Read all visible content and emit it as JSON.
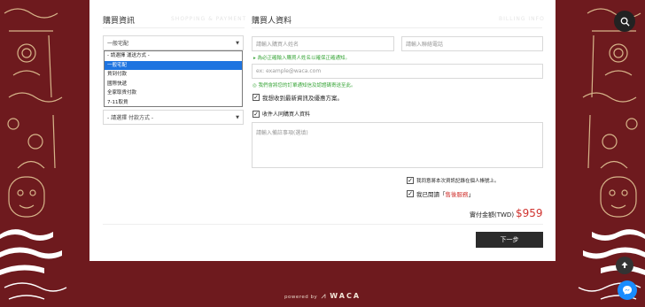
{
  "left_section": {
    "title": "購買資訊",
    "title_en": "SHOPPING & PAYMENT",
    "shipping_select_value": "一般宅配",
    "shipping_options": [
      "- 請選擇 運送方式 -",
      "一般宅配",
      "貨到付款",
      "國際快遞",
      "全家取貨付款",
      "7-11取貨"
    ],
    "payment_select_value": "- 請選擇 付款方式 -"
  },
  "right_section": {
    "title": "購買人資料",
    "title_en": "BILLING INFO",
    "name_placeholder": "請輸入購買人姓名",
    "phone_placeholder": "請輸入聯絡電話",
    "name_hint": "▸ 為必正確輸入購買人姓名以確保正確通知。",
    "email_placeholder": "ex: example@waca.com",
    "email_hint": "◎ 我們會將您的訂單通知信及認證碼寄送至此。",
    "subscribe_label": "我想收到最新資訊及優惠方案。",
    "same_as_buyer_label": "收件人同購買人資料",
    "note_placeholder": "請輸入備註事項(選填)",
    "agree_record_label": "我同意將本次資訊記錄在個人帳號上。",
    "agree_policy_prefix": "我已閱讀「",
    "agree_policy_link": "售後服務",
    "agree_policy_suffix": "」",
    "total_label": "實付金額(TWD)",
    "total_value": "$959",
    "next_button": "下一步"
  },
  "footer": {
    "powered_by": "powered by",
    "brand": "WACA"
  },
  "icons": {
    "search": "search-icon",
    "upload": "upload-icon",
    "messenger": "messenger-icon"
  },
  "colors": {
    "background": "#6e1a1e",
    "accent_red": "#d0332f",
    "hint_green": "#3aa63a",
    "dropdown_highlight": "#1e74e0",
    "button_dark": "#2b2b2b",
    "messenger_blue": "#1a8cff"
  }
}
